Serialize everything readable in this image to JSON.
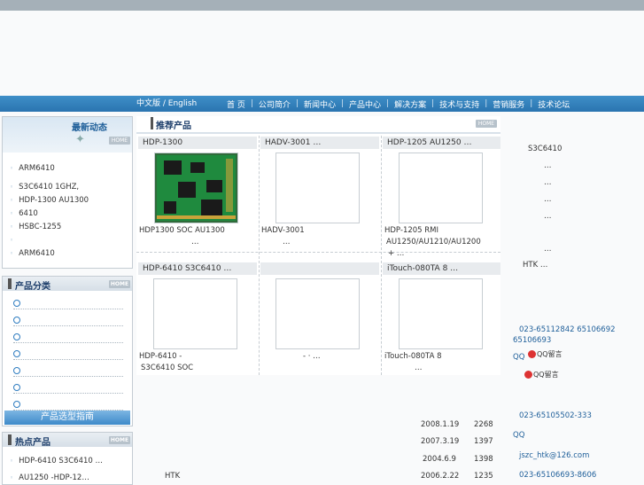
{
  "nav": {
    "lang": "中文版 / English",
    "items": [
      "首 页",
      "公司简介",
      "新闻中心",
      "产品中心",
      "解决方案",
      "技术与支持",
      "营销服务",
      "技术论坛"
    ]
  },
  "home_btn": "HOME",
  "news": {
    "title": "最新动态",
    "items": [
      "ARM6410",
      "S3C6410        1GHZ,",
      "HDP-1300 AU1300",
      "6410",
      "HSBC-1255",
      "",
      "ARM6410"
    ]
  },
  "featured": {
    "title": "推荐产品",
    "row1": [
      {
        "head": "HDP-1300",
        "desc1": "HDP1300          SOC AU1300",
        "desc2": "…"
      },
      {
        "head": "HADV-3001     …",
        "desc1": "HADV-3001",
        "desc2": "…"
      },
      {
        "head": "HDP-1205 AU1250   …",
        "desc1": "HDP-1205       RMI",
        "desc2": "AU1250/AU1210/AU1200",
        "desc3": "+             …"
      }
    ],
    "row2": [
      {
        "head": "HDP-6410 S3C6410  …",
        "desc1": "HDP-6410   -",
        "desc2": "S3C6410 SOC"
      },
      {
        "head": "",
        "desc1": "-   ·               …",
        "desc2": ""
      },
      {
        "head": "iTouch-080TA 8   …",
        "desc1": "iTouch-080TA 8",
        "desc2": "…"
      }
    ]
  },
  "categories": {
    "title": "产品分类",
    "guide": "产品选型指南",
    "count": 7
  },
  "hot": {
    "title": "热点产品",
    "items": [
      "HDP-6410 S3C6410  …",
      "AU1250   -HDP-12…"
    ]
  },
  "right": {
    "s3c": "S3C6410",
    "dots": [
      "…",
      "…",
      "…",
      "…",
      "…"
    ],
    "htk": "HTK        …",
    "phone1": "023-65112842 65106692",
    "phone1b": "65106693",
    "qq": "QQ",
    "qq_msg": "QQ留言",
    "phone2": "023-65105502-333",
    "qq2": "QQ",
    "email": "jszc_htk@126.com",
    "phone3": "023-65106693-8606"
  },
  "downloads": [
    {
      "date": "2008.1.19",
      "count": "2268"
    },
    {
      "date": "2007.3.19",
      "count": "1397"
    },
    {
      "date": "2004.6.9",
      "count": "1398"
    },
    {
      "date": "2006.2.22",
      "count": "1235"
    }
  ],
  "bottom_htk": "HTK"
}
